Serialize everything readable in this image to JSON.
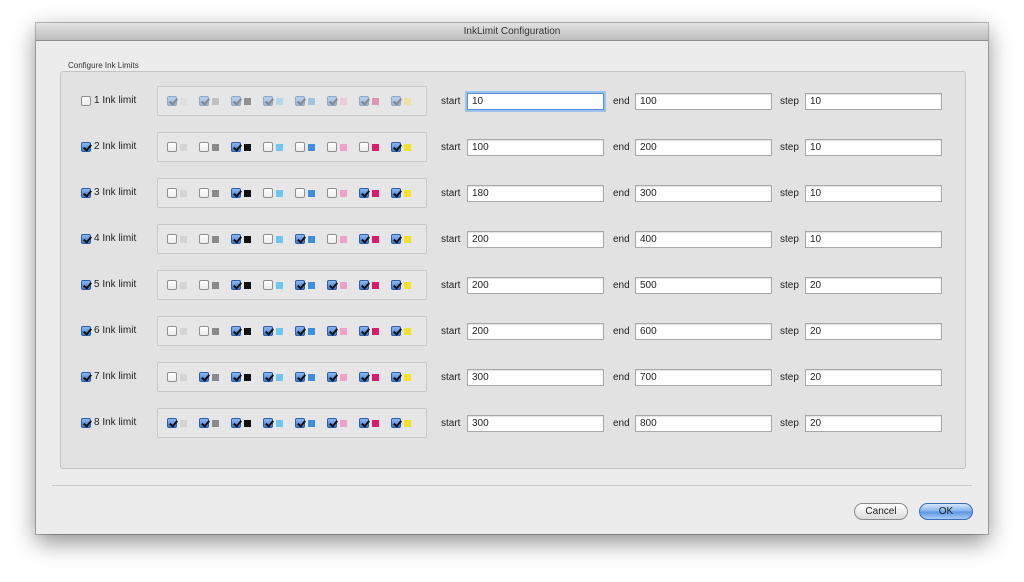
{
  "window": {
    "title": "InkLimit Configuration"
  },
  "group": {
    "label": "Configure Ink Limits"
  },
  "labels": {
    "start": "start",
    "end": "end",
    "step": "step"
  },
  "channel_colors": [
    "#d4d4d4",
    "#8a8a8a",
    "#111111",
    "#6cc6ef",
    "#3c8fe0",
    "#f3a0c8",
    "#d81b6a",
    "#f4e12c"
  ],
  "rows": [
    {
      "label": "1 Ink limit",
      "enabled": false,
      "channels": [
        true,
        true,
        true,
        true,
        true,
        true,
        true,
        true
      ],
      "start": "10",
      "end": "100",
      "step": "10"
    },
    {
      "label": "2 Ink limit",
      "enabled": true,
      "channels": [
        false,
        false,
        true,
        false,
        false,
        false,
        false,
        true
      ],
      "start": "100",
      "end": "200",
      "step": "10"
    },
    {
      "label": "3 Ink limit",
      "enabled": true,
      "channels": [
        false,
        false,
        true,
        false,
        false,
        false,
        true,
        true
      ],
      "start": "180",
      "end": "300",
      "step": "10"
    },
    {
      "label": "4 Ink limit",
      "enabled": true,
      "channels": [
        false,
        false,
        true,
        false,
        true,
        false,
        true,
        true
      ],
      "start": "200",
      "end": "400",
      "step": "10"
    },
    {
      "label": "5 Ink limit",
      "enabled": true,
      "channels": [
        false,
        false,
        true,
        false,
        true,
        true,
        true,
        true
      ],
      "start": "200",
      "end": "500",
      "step": "20"
    },
    {
      "label": "6 Ink limit",
      "enabled": true,
      "channels": [
        false,
        false,
        true,
        true,
        true,
        true,
        true,
        true
      ],
      "start": "200",
      "end": "600",
      "step": "20"
    },
    {
      "label": "7 Ink limit",
      "enabled": true,
      "channels": [
        false,
        true,
        true,
        true,
        true,
        true,
        true,
        true
      ],
      "start": "300",
      "end": "700",
      "step": "20"
    },
    {
      "label": "8 Ink limit",
      "enabled": true,
      "channels": [
        true,
        true,
        true,
        true,
        true,
        true,
        true,
        true
      ],
      "start": "300",
      "end": "800",
      "step": "20"
    }
  ],
  "buttons": {
    "cancel": "Cancel",
    "ok": "OK"
  }
}
